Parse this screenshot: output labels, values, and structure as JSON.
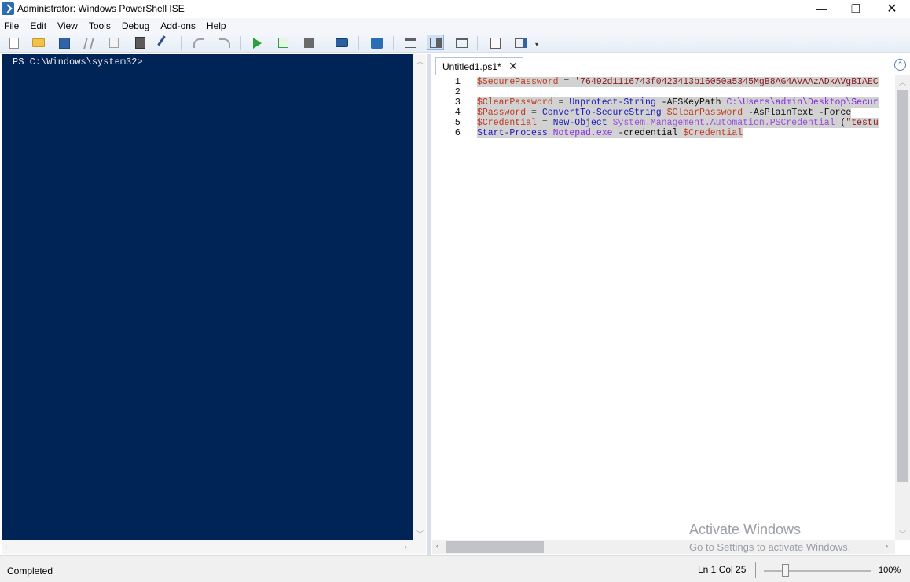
{
  "window": {
    "title": "Administrator: Windows PowerShell ISE",
    "controls": {
      "minimize": "—",
      "maximize": "❐",
      "close": "✕"
    }
  },
  "menu": [
    "File",
    "Edit",
    "View",
    "Tools",
    "Debug",
    "Add-ons",
    "Help"
  ],
  "toolbar": {
    "icons": [
      "new-script-icon",
      "open-icon",
      "save-icon",
      "cut-icon",
      "copy-icon",
      "paste-icon",
      "clear-console-icon",
      "undo-icon",
      "redo-icon",
      "run-script-icon",
      "run-selection-icon",
      "stop-icon",
      "new-remote-tab-icon",
      "start-powershell-icon",
      "show-script-pane-top-icon",
      "show-script-pane-right-icon",
      "show-script-pane-maximized-icon",
      "show-snippets-icon",
      "show-commands-icon"
    ],
    "active_layout": "show-script-pane-right"
  },
  "console": {
    "prompt": "PS C:\\Windows\\system32>"
  },
  "editor": {
    "tab_label": "Untitled1.ps1*",
    "tab_close": "✕",
    "collapse": "⌃",
    "lines": [
      {
        "number": "1",
        "tokens": [
          {
            "t": "$SecurePassword",
            "c": "var"
          },
          {
            "t": " = ",
            "c": "op"
          },
          {
            "t": "'76492d1116743f0423413b16050a5345MgB8AG4AVAAzADkAVgBIAEC",
            "c": "str"
          }
        ]
      },
      {
        "number": "2",
        "tokens": []
      },
      {
        "number": "3",
        "tokens": [
          {
            "t": "$ClearPassword",
            "c": "var"
          },
          {
            "t": " = ",
            "c": "op"
          },
          {
            "t": "Unprotect-String",
            "c": "cmd"
          },
          {
            "t": " -AESKeyPath ",
            "c": "param"
          },
          {
            "t": "C:\\Users\\admin\\Desktop\\Secur",
            "c": "path"
          }
        ]
      },
      {
        "number": "4",
        "tokens": [
          {
            "t": "$Password",
            "c": "var"
          },
          {
            "t": " = ",
            "c": "op"
          },
          {
            "t": "ConvertTo-SecureString",
            "c": "cmd"
          },
          {
            "t": " ",
            "c": "op"
          },
          {
            "t": "$ClearPassword",
            "c": "var"
          },
          {
            "t": " -AsPlainText -Force",
            "c": "param"
          }
        ]
      },
      {
        "number": "5",
        "tokens": [
          {
            "t": "$Credential",
            "c": "var"
          },
          {
            "t": " = ",
            "c": "op"
          },
          {
            "t": "New-Object",
            "c": "cmd"
          },
          {
            "t": " ",
            "c": "op"
          },
          {
            "t": "System.Management.Automation.PSCredential",
            "c": "type"
          },
          {
            "t": " (",
            "c": "param"
          },
          {
            "t": "\"testu",
            "c": "str"
          }
        ]
      },
      {
        "number": "6",
        "tokens": [
          {
            "t": "Start-Process",
            "c": "cmd"
          },
          {
            "t": " ",
            "c": "op"
          },
          {
            "t": "Notepad.exe",
            "c": "path"
          },
          {
            "t": " -credential ",
            "c": "param"
          },
          {
            "t": "$Credential",
            "c": "var"
          }
        ]
      }
    ]
  },
  "watermark": {
    "title": "Activate Windows",
    "subtitle": "Go to Settings to activate Windows."
  },
  "status": {
    "text": "Completed",
    "position": "Ln 1  Col 25",
    "zoom": "100%",
    "zoom_fraction": 0.2
  },
  "colors": {
    "console_bg": "#012456",
    "console_fg": "#eeedf0",
    "variable": "#c03a1f",
    "command": "#1c1cb8",
    "string": "#8b1a1a",
    "type": "#9b4fd8",
    "selection": "#d2d2d2"
  }
}
